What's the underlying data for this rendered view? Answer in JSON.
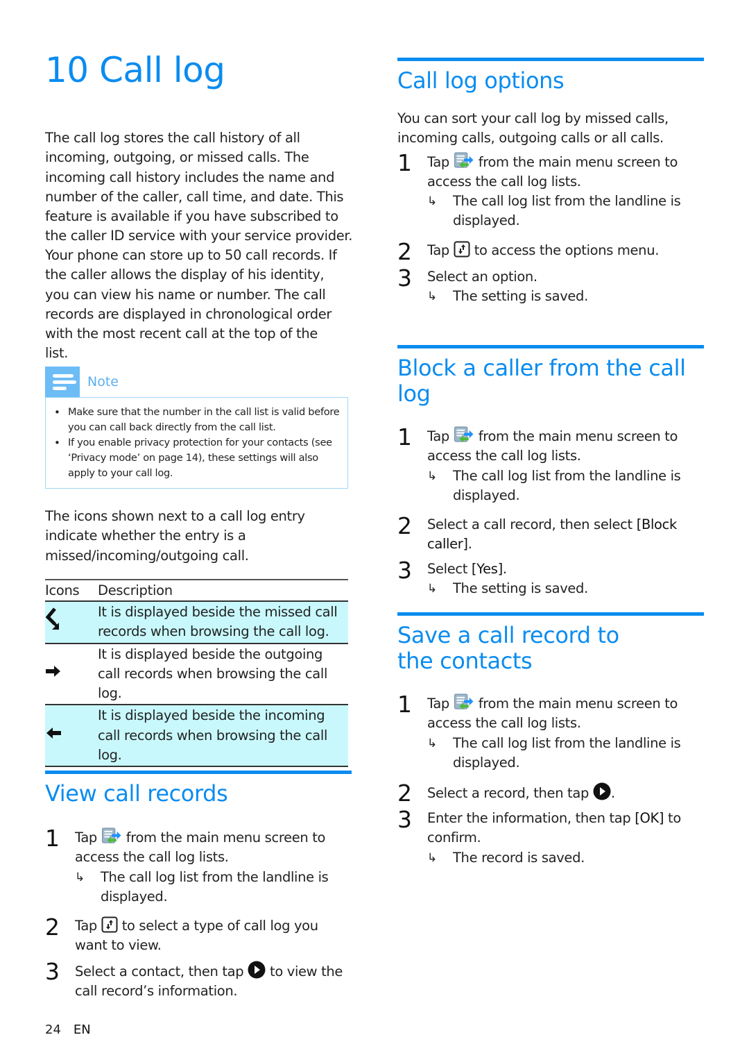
{
  "chapter": {
    "title": "10 Call log",
    "intro_p1": "The call log stores the call history of all incoming, outgoing, or missed calls. The incoming call history includes the name and number of the caller, call time, and date. This feature is available if you have subscribed to the caller ID service with your service provider.",
    "intro_p2": "Your phone can store up to 50 call records. If the caller allows the display of his identity, you can view his name or number. The call records are displayed in chronological order with the most recent call at the top of the list."
  },
  "note": {
    "label": "Note",
    "icon": "note-lines-icon",
    "items": [
      "Make sure that the number in the call list is valid before you can call back directly from the call list.",
      "If you enable privacy protection for your contacts (see ‘Privacy mode’ on page 14), these settings will also apply to your call log."
    ]
  },
  "icons_intro": "The icons shown next to a call log entry indicate whether the entry is a missed/incoming/outgoing call.",
  "icon_table": {
    "headers": [
      "Icons",
      "Description"
    ],
    "rows": [
      {
        "icon": "missed-call-icon",
        "description": "It is displayed beside the missed call records when browsing the call log."
      },
      {
        "icon": "outgoing-call-icon",
        "description": "It is displayed beside the outgoing call records when browsing the call log."
      },
      {
        "icon": "incoming-call-icon",
        "description": "It is displayed beside the incoming call records when browsing the call log."
      }
    ]
  },
  "view_records": {
    "title": "View call records",
    "steps": [
      {
        "num": "1",
        "pre": "Tap",
        "icon": "call-log-menu-icon",
        "post": "from the main menu screen to access the call log lists.",
        "result": "The call log list from the landline is displayed."
      },
      {
        "num": "2",
        "pre": "Tap",
        "icon": "options-icon",
        "post": "to select a type of call log you want to view."
      },
      {
        "num": "3",
        "pre": "Select a contact, then tap",
        "icon": "play-icon",
        "post": "to view the call record’s information."
      }
    ]
  },
  "options": {
    "title": "Call log options",
    "intro": "You can sort your call log by missed calls, incoming calls, outgoing calls or all calls.",
    "steps": [
      {
        "num": "1",
        "pre": "Tap",
        "icon": "call-log-menu-icon",
        "post": "from the main menu screen to access the call log lists.",
        "result": "The call log list from the landline is displayed."
      },
      {
        "num": "2",
        "pre": "Tap",
        "icon": "options-icon",
        "post": "to access the options menu."
      },
      {
        "num": "3",
        "text": "Select an option.",
        "result": "The setting is saved."
      }
    ]
  },
  "block": {
    "title": "Block a caller from the call log",
    "steps": [
      {
        "num": "1",
        "pre": "Tap",
        "icon": "call-log-menu-icon",
        "post": "from the main menu screen to access the call log lists.",
        "result": "The call log list from the landline is displayed."
      },
      {
        "num": "2",
        "pre": "Select a call record, then select",
        "ui": "[Block caller]",
        "post": "."
      },
      {
        "num": "3",
        "pre": "Select",
        "ui": "[Yes]",
        "post": ".",
        "result": "The setting is saved."
      }
    ]
  },
  "save": {
    "title": "Save a call record to the contacts",
    "steps": [
      {
        "num": "1",
        "pre": "Tap",
        "icon": "call-log-menu-icon",
        "post": "from the main menu screen to access the call log lists.",
        "result": "The call log list from the landline is displayed."
      },
      {
        "num": "2",
        "pre": "Select a record, then tap",
        "icon": "play-icon",
        "post": "."
      },
      {
        "num": "3",
        "pre": "Enter the information, then tap",
        "ui": "[OK]",
        "post": "to confirm.",
        "result": "The record is saved."
      }
    ]
  },
  "result_arrow": "↳",
  "footer": {
    "page": "24",
    "lang": "EN"
  },
  "colors": {
    "accent": "#0a8cf0",
    "note_accent": "#6cbcf6",
    "table_shade": "#c8f8fc"
  }
}
